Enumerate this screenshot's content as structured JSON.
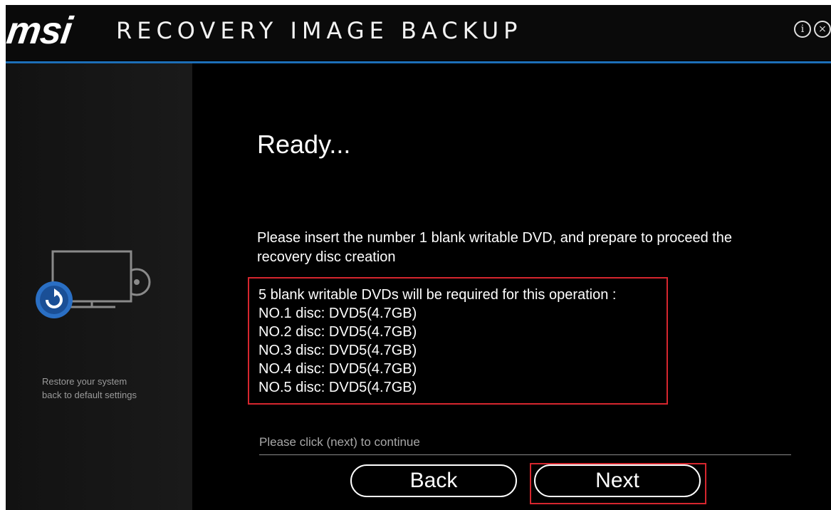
{
  "titlebar": {
    "logo": "msi",
    "app_title": "RECOVERY IMAGE BACKUP",
    "info_icon": "info-icon",
    "close_icon": "close-icon"
  },
  "colors": {
    "accent_blue": "#1d6fb8",
    "highlight_red": "#d6262e"
  },
  "sidebar": {
    "icon": "monitor-disc-restore-icon",
    "caption_line1": "Restore your system",
    "caption_line2": "back to default settings"
  },
  "main": {
    "heading": "Ready...",
    "instruction": "Please insert the  number 1  blank writable DVD, and prepare to proceed the recovery disc creation",
    "requirements": {
      "summary": "5 blank writable DVDs will be required for this operation :",
      "discs": [
        "NO.1 disc: DVD5(4.7GB)",
        "NO.2 disc: DVD5(4.7GB)",
        "NO.3 disc: DVD5(4.7GB)",
        "NO.4 disc: DVD5(4.7GB)",
        "NO.5 disc: DVD5(4.7GB)"
      ]
    },
    "continue_text": "Please click (next) to continue"
  },
  "buttons": {
    "back_label": "Back",
    "next_label": "Next"
  }
}
